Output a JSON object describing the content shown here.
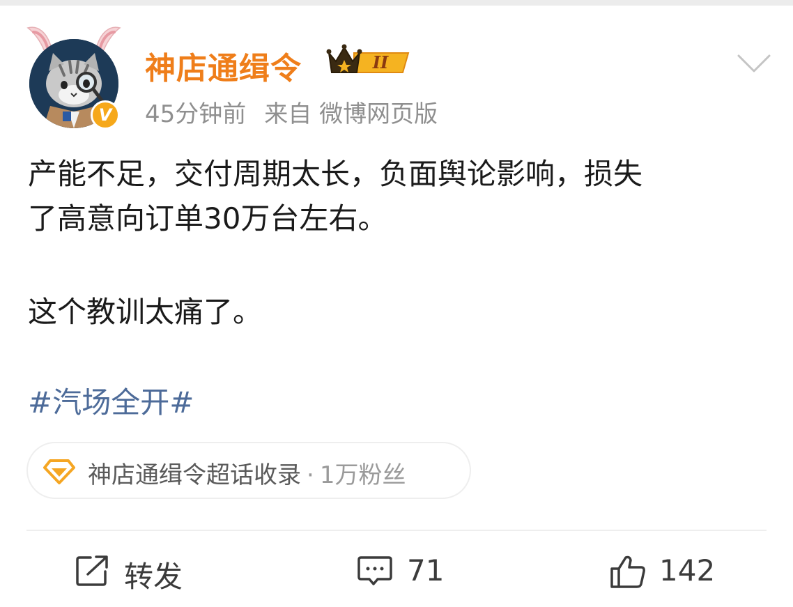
{
  "post": {
    "author": "神店通缉令",
    "level_badge": "II",
    "time": "45分钟前",
    "source": "来自 微博网页版",
    "text_line1": "产能不足，交付周期太长，负面舆论影响，损失",
    "text_line2": "了高意向订单30万台左右。",
    "text_para2": "这个教训太痛了。",
    "hashtag": "#汽场全开#"
  },
  "super_topic": {
    "name": "神店通缉令超话收录",
    "dot": "·",
    "fans": "1万粉丝"
  },
  "actions": {
    "repost_label": "转发",
    "comment_count": "71",
    "like_count": "142"
  },
  "colors": {
    "username": "#ef7e1a",
    "hashtag": "#4d6b99",
    "verified_badge": "#f6a81a"
  },
  "icons": {
    "verified": "v-verified-icon",
    "crown": "crown-level-icon",
    "menu": "chevron-down-icon",
    "topic": "diamond-topic-icon",
    "repost": "share-icon",
    "comment": "comment-icon",
    "like": "thumbs-up-icon"
  }
}
